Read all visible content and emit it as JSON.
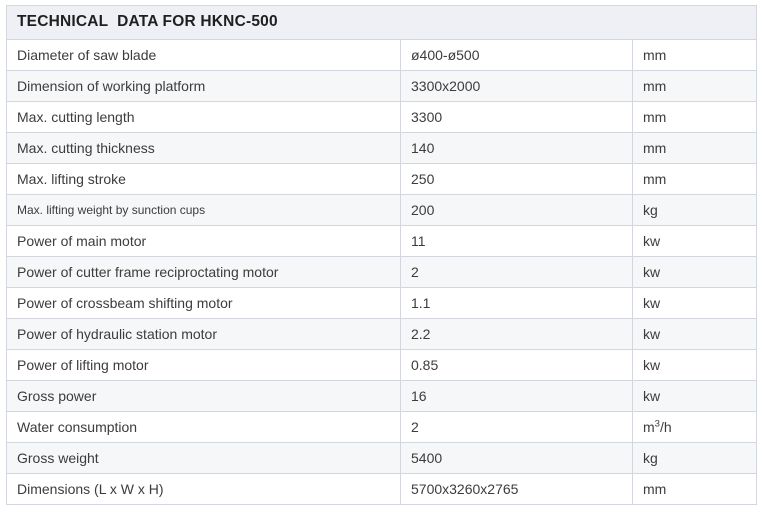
{
  "table": {
    "title": "TECHNICAL  DATA FOR HKNC-500",
    "rows": [
      {
        "parameter": "Diameter of saw blade",
        "value": "ø400-ø500",
        "unit": "mm",
        "small": false
      },
      {
        "parameter": "Dimension of working platform",
        "value": "3300x2000",
        "unit": "mm",
        "small": false
      },
      {
        "parameter": "Max. cutting length",
        "value": "3300",
        "unit": "mm",
        "small": false
      },
      {
        "parameter": "Max. cutting thickness",
        "value": "140",
        "unit": "mm",
        "small": false
      },
      {
        "parameter": "Max. lifting stroke",
        "value": "250",
        "unit": "mm",
        "small": false
      },
      {
        "parameter": "Max. lifting weight by sunction cups",
        "value": "200",
        "unit": "kg",
        "small": true
      },
      {
        "parameter": "Power of main motor",
        "value": "11",
        "unit": "kw",
        "small": false
      },
      {
        "parameter": "Power of cutter frame reciproctating motor",
        "value": "2",
        "unit": "kw",
        "small": false
      },
      {
        "parameter": "Power of crossbeam shifting motor",
        "value": "1.1",
        "unit": "kw",
        "small": false
      },
      {
        "parameter": "Power of hydraulic station motor",
        "value": "2.2",
        "unit": "kw",
        "small": false
      },
      {
        "parameter": "Power of lifting motor",
        "value": "0.85",
        "unit": "kw",
        "small": false
      },
      {
        "parameter": "Gross power",
        "value": "16",
        "unit": "kw",
        "small": false
      },
      {
        "parameter": "Water consumption",
        "value": "2",
        "unit": "m3/h",
        "unit_base": "m",
        "unit_sup": "3",
        "unit_tail": "/h",
        "small": false
      },
      {
        "parameter": "Gross weight",
        "value": "5400",
        "unit": "kg",
        "small": false
      },
      {
        "parameter": "Dimensions (L x W x H)",
        "value": "5700x3260x2765",
        "unit": "mm",
        "small": false
      }
    ]
  },
  "colors": {
    "header_background": "#eef0f5",
    "row_alt_background": "#f6f7f9",
    "row_background": "#ffffff",
    "border": "#d3d7dd",
    "text": "#3c3c3c",
    "title_text": "#1f1f1f"
  }
}
